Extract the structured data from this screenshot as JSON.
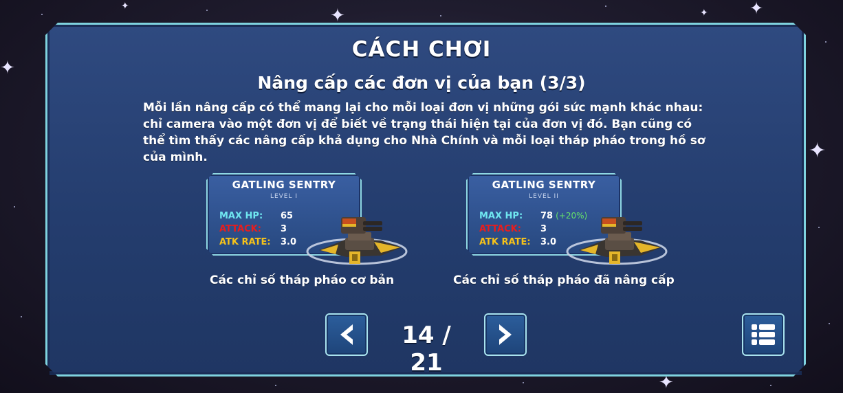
{
  "title": "CÁCH CHƠI",
  "subtitle": "Nâng cấp các đơn vị của bạn (3/3)",
  "description": "Mỗi lần nâng cấp có thể mang lại cho mỗi loại đơn vị những gói sức mạnh khác nhau: chỉ camera vào một đơn vị để biết về trạng thái hiện tại của đơn vị đó.  Bạn cũng có thể tìm thấy các nâng cấp khả dụng cho Nhà Chính  và mỗi loại tháp pháo trong hồ sơ của mình.",
  "cards": [
    {
      "name": "GATLING SENTRY",
      "level": "LEVEL I",
      "hp_label": "MAX HP:",
      "hp_value": "65",
      "hp_bonus": "",
      "attack_label": "ATTACK:",
      "attack_value": "3",
      "rate_label": "ATK RATE:",
      "rate_value": "3.0",
      "caption": "Các chỉ số tháp pháo cơ bản"
    },
    {
      "name": "GATLING SENTRY",
      "level": "LEVEL II",
      "hp_label": "MAX HP:",
      "hp_value": "78",
      "hp_bonus": "(+20%)",
      "attack_label": "ATTACK:",
      "attack_value": "3",
      "rate_label": "ATK RATE:",
      "rate_value": "3.0",
      "caption": "Các chỉ số tháp pháo đã nâng cấp"
    }
  ],
  "pagination": {
    "current": "14 / 21"
  },
  "icons": {
    "prev": "chevron-left-icon",
    "next": "chevron-right-icon",
    "menu": "list-menu-icon",
    "turret": "gatling-turret-icon"
  },
  "colors": {
    "panel": "#2f4a80",
    "border": "#7fd3df",
    "hp_label": "#6fe6f0",
    "attack_label": "#e81d1d",
    "rate_label": "#f5c21a",
    "bonus": "#66e36a"
  }
}
